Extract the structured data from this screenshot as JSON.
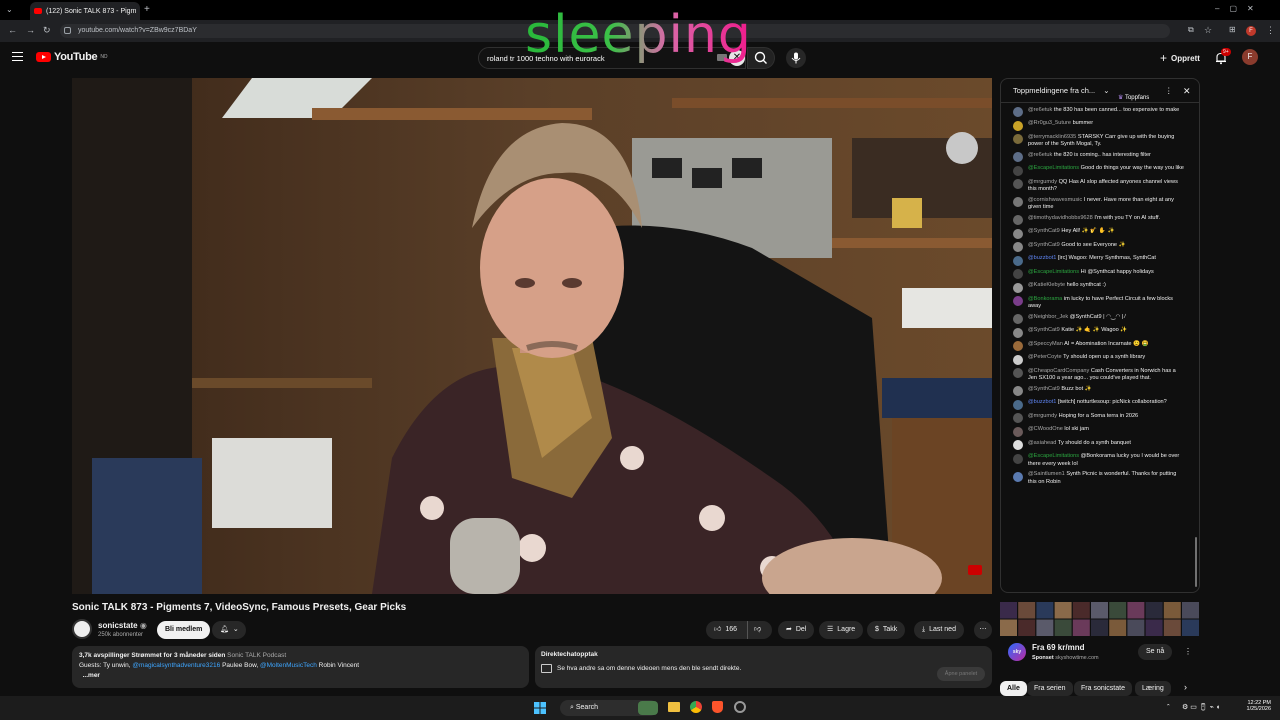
{
  "browser": {
    "tab_title": "(122) Sonic TALK 873 - Pigm",
    "url": "youtube.com/watch?v=ZBw9cz7BDaY"
  },
  "header": {
    "logo_text": "YouTube",
    "logo_region": "NO",
    "search_value": "roland tr 1000 techno with eurorack",
    "overlay_word": "sleeping",
    "create_label": "Opprett",
    "notif_count": "9+",
    "avatar_letter": "F"
  },
  "video": {
    "title": "Sonic TALK 873 - Pigments 7, VideoSync, Famous Presets, Gear Picks",
    "channel_name": "sonicstate",
    "subscribers": "250k abonnenter",
    "join_label": "Bli medlem",
    "likes": "166",
    "share_label": "Del",
    "save_label": "Lagre",
    "thanks_label": "Takk",
    "download_label": "Last ned"
  },
  "description": {
    "stats": "3,7k avspillinger  Strømmet for 3 måneder siden",
    "podcast": "Sonic TALK Podcast",
    "guests_prefix": "Guests: Ty unwin,",
    "link1": "@magicalsynthadventure3216",
    "guest2": "Paulee Bow,",
    "link2": "@MoltenMusicTech",
    "guest3": "Robin Vincent",
    "more": "...mer"
  },
  "live_replay": {
    "title": "Direktechatopptak",
    "text": "Se hva andre sa om denne videoen mens den ble sendt direkte.",
    "button": "Åpne panelet"
  },
  "chat": {
    "header": "Toppmeldingene fra ch...",
    "toppfans": "Toppfans",
    "messages": [
      {
        "author": "@re6etuk",
        "text": "the 830 has been canned... too expensive to make",
        "color": "#5d6d87",
        "type": "normal"
      },
      {
        "author": "@Rr0gu3_5uture",
        "text": "bummer",
        "color": "#c9a227",
        "type": "normal"
      },
      {
        "author": "@terrymacklin6935",
        "text": "STARSKY Carr give up with the buying power of the Synth Mogal, Ty.",
        "color": "#7a6a3a",
        "type": "normal"
      },
      {
        "author": "@re6etuk",
        "text": "the 820 is coming.. has interesting filter",
        "color": "#5d6d87",
        "type": "normal"
      },
      {
        "author": "@EscapeLimitations",
        "text": "Good do things your way the way you like",
        "color": "#444",
        "type": "member"
      },
      {
        "author": "@mrgumdy",
        "text": "QQ Has AI slop affected anyones channel views this month?",
        "color": "#555",
        "type": "normal"
      },
      {
        "author": "@cornishwavesmusic",
        "text": "I never. Have more than eight at any given time",
        "color": "#777",
        "type": "normal"
      },
      {
        "author": "@timothydavidhobbs9628",
        "text": "I'm with you TY on AI stuff.",
        "color": "#666",
        "type": "normal"
      },
      {
        "author": "@SynthCat9",
        "text": "Hey All! ✨ 🎷 ✋ ✨",
        "color": "#888",
        "type": "normal"
      },
      {
        "author": "@SynthCat9",
        "text": "Good to see Everyone ✨",
        "color": "#888",
        "type": "normal"
      },
      {
        "author": "@buzzbot1",
        "text": "[irc] Wagoo: Merry Synthmas, SynthCat",
        "color": "#4a6a8a",
        "type": "mod"
      },
      {
        "author": "@EscapeLimitations",
        "text": "Hi @Synthcat happy holidays",
        "color": "#444",
        "type": "member"
      },
      {
        "author": "@KatieKlebyte",
        "text": "hello synthcat :)",
        "color": "#999",
        "type": "normal"
      },
      {
        "author": "@Bonkorama",
        "text": "im lucky to have Perfect Circuit a few blocks away",
        "color": "#7a3d8a",
        "type": "member"
      },
      {
        "author": "@Neighbor_Jek",
        "text": "@SynthCat9 | ◠‿◠ |ﾉ",
        "color": "#666",
        "type": "normal"
      },
      {
        "author": "@SynthCat9",
        "text": "Katie ✨ 🤙 ✨ Wagoo ✨",
        "color": "#888",
        "type": "normal"
      },
      {
        "author": "@SpeccyMan",
        "text": "AI = Abomination Incarnate 😉 🤮",
        "color": "#9a6a3a",
        "type": "normal"
      },
      {
        "author": "@PeterCoyte",
        "text": "Ty should open up a synth library",
        "color": "#ccc",
        "type": "normal"
      },
      {
        "author": "@CheapoCardCompany",
        "text": "Cash Converters in Norwich has a Jen SX100 a year ago... you could've played that.",
        "color": "#555",
        "type": "normal"
      },
      {
        "author": "@SynthCat9",
        "text": "Buzz bot ✨",
        "color": "#888",
        "type": "normal"
      },
      {
        "author": "@buzzbot1",
        "text": "[twitch] notturtlesoup: picNick collaboration?",
        "color": "#4a6a8a",
        "type": "mod"
      },
      {
        "author": "@mrgumdy",
        "text": "Hoping for a Soma terra in 2026",
        "color": "#555",
        "type": "normal"
      },
      {
        "author": "@CWoodOne",
        "text": "lol ski jam",
        "color": "#6a5a5a",
        "type": "normal"
      },
      {
        "author": "@asiahead",
        "text": "Ty should do a synth banquet",
        "color": "#ddd",
        "type": "normal"
      },
      {
        "author": "@EscapeLimitations",
        "text": "@Bonkorama lucky you I would be over there every week lol",
        "color": "#444",
        "type": "member"
      },
      {
        "author": "@Saintlumen1",
        "text": "Synth Picnic is wonderful. Thanks for putting this on Robin",
        "color": "#5a7ab0",
        "type": "normal"
      }
    ]
  },
  "ad": {
    "title": "Fra 69 kr/mnd",
    "sponsored": "Sponset",
    "domain": "skyshowtime.com",
    "cta": "Se nå",
    "chips": [
      "Alle",
      "Fra serien",
      "Fra sonicstate",
      "Læring"
    ]
  },
  "taskbar": {
    "search_label": "Search",
    "time": "12:22 PM",
    "date": "1/25/2026"
  }
}
